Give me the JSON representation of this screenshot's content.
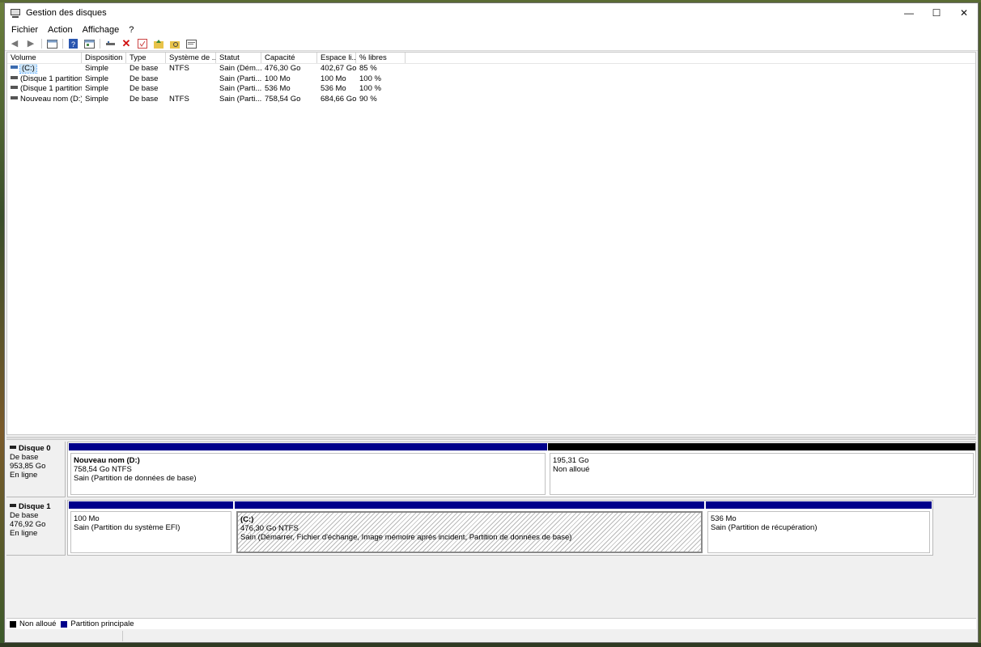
{
  "window": {
    "title": "Gestion des disques",
    "buttons": {
      "minimize": "—",
      "maximize": "☐",
      "close": "✕"
    }
  },
  "menu": [
    "Fichier",
    "Action",
    "Affichage",
    "?"
  ],
  "toolbar": {
    "icons": [
      "back-arrow-icon",
      "forward-arrow-icon",
      "console-tree-icon",
      "help-icon",
      "properties-icon",
      "connect-icon",
      "delete-icon",
      "check-icon",
      "folder-up-icon",
      "folder-search-icon",
      "window-icon"
    ]
  },
  "volume_list": {
    "columns": [
      "Volume",
      "Disposition",
      "Type",
      "Système de ...",
      "Statut",
      "Capacité",
      "Espace li...",
      "% libres"
    ],
    "rows": [
      [
        "(C:)",
        "Simple",
        "De base",
        "NTFS",
        "Sain (Dém...",
        "476,30 Go",
        "402,67 Go",
        "85 %"
      ],
      [
        "(Disque 1 partition...",
        "Simple",
        "De base",
        "",
        "Sain (Parti...",
        "100 Mo",
        "100 Mo",
        "100 %"
      ],
      [
        "(Disque 1 partition...",
        "Simple",
        "De base",
        "",
        "Sain (Parti...",
        "536 Mo",
        "536 Mo",
        "100 %"
      ],
      [
        "Nouveau nom (D:)",
        "Simple",
        "De base",
        "NTFS",
        "Sain (Parti...",
        "758,54 Go",
        "684,66 Go",
        "90 %"
      ]
    ]
  },
  "disks": [
    {
      "name": "Disque 0",
      "type": "De base",
      "size": "953,85 Go",
      "state": "En ligne",
      "partitions": [
        {
          "title": "Nouveau nom  (D:)",
          "line1": "758,54 Go NTFS",
          "line2": "Sain (Partition de données de base)",
          "kind": "primary"
        },
        {
          "title": "",
          "line1": "195,31 Go",
          "line2": "Non alloué",
          "kind": "unallocated"
        }
      ]
    },
    {
      "name": "Disque 1",
      "type": "De base",
      "size": "476,92 Go",
      "state": "En ligne",
      "partitions": [
        {
          "title": "",
          "line1": "100 Mo",
          "line2": "Sain (Partition du système EFI)",
          "kind": "primary"
        },
        {
          "title": "(C:)",
          "line1": "476,30 Go NTFS",
          "line2": "Sain (Démarrer, Fichier d'échange, Image mémoire après incident, Partition de données de base)",
          "kind": "primary"
        },
        {
          "title": "",
          "line1": "536 Mo",
          "line2": "Sain (Partition de récupération)",
          "kind": "primary"
        }
      ]
    }
  ],
  "legend": [
    {
      "label": "Non alloué",
      "color": "#000000"
    },
    {
      "label": "Partition principale",
      "color": "#00008b"
    }
  ],
  "colors": {
    "primary_partition": "#00008b",
    "unallocated": "#000000",
    "selection": "#cce4f7"
  }
}
